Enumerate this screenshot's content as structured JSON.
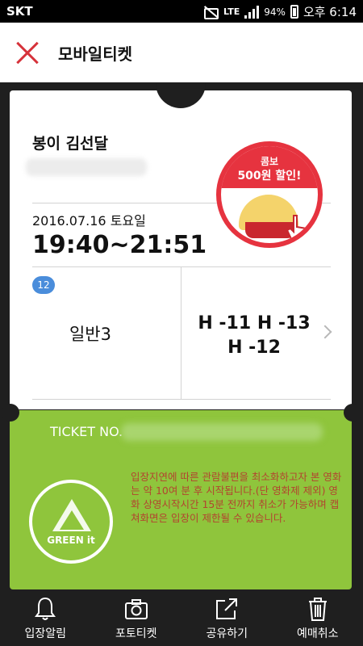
{
  "status_bar": {
    "carrier": "SKT",
    "network": "LTE",
    "battery_percent": "94%",
    "time": "오후 6:14"
  },
  "header": {
    "title": "모바일티켓"
  },
  "ticket": {
    "movie_title": "봉이 김선달",
    "date": "2016.07.16 토요일",
    "time": "19:40~21:51",
    "age_rating": "12",
    "seat_type": "일반3",
    "seats_line1": "H -11 H -13",
    "seats_line2": "H -12",
    "promo": {
      "line1": "콤보",
      "line2": "500원 할인!"
    },
    "ticket_no_label": "TICKET NO.",
    "green_logo_text": "GREEN it",
    "notice": "입장지연에 따른 관람불편을 최소화하고자 본 영화는 약 10여 분 후 시작됩니다.(단 영화제 제외) 영화 상영시작시간 15분 전까지 취소가 가능하며 캡쳐화면은 입장이 제한될 수 있습니다."
  },
  "bottom_nav": {
    "items": [
      {
        "label": "입장알림",
        "icon": "bell-icon"
      },
      {
        "label": "포토티켓",
        "icon": "camera-icon"
      },
      {
        "label": "공유하기",
        "icon": "share-icon"
      },
      {
        "label": "예매취소",
        "icon": "trash-icon"
      }
    ]
  },
  "colors": {
    "accent_red": "#d6333b",
    "ticket_green": "#8fc53c",
    "background": "#1f1f1f",
    "badge_blue": "#4a8ddb"
  }
}
